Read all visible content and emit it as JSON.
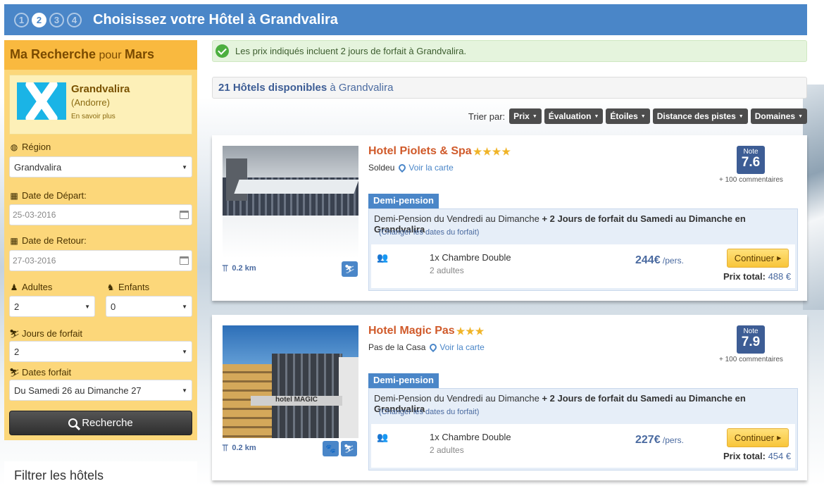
{
  "header": {
    "steps": [
      "1",
      "2",
      "3",
      "4"
    ],
    "title": "Choisissez votre Hôtel à Grandvalira"
  },
  "sidebar": {
    "title_main": "Ma Recherche",
    "title_for": " pour ",
    "title_month": "Mars",
    "resort": {
      "name": "Grandvalira",
      "country": "(Andorre)",
      "more": "En savoir plus"
    },
    "region_label": "Région",
    "region_value": "Grandvalira",
    "depart_label": "Date de Départ:",
    "depart_value": "25-03-2016",
    "return_label": "Date de Retour:",
    "return_value": "27-03-2016",
    "adults_label": "Adultes",
    "adults_value": "2",
    "children_label": "Enfants",
    "children_value": "0",
    "skidays_label": "Jours de forfait",
    "skidays_value": "2",
    "skidates_label": "Dates forfait",
    "skidates_value": "Du Samedi 26 au Dimanche 27",
    "search_button": "Recherche",
    "filter_title": "Filtrer les hôtels"
  },
  "main": {
    "notice": "Les prix indiqués incluent 2 jours de forfait à Grandvalira.",
    "count_bold": "21 Hôtels disponibles",
    "count_rest": " à Grandvalira",
    "sort_label": "Trier par:",
    "sort_buttons": [
      "Prix",
      "Évaluation",
      "Étoiles",
      "Distance des pistes",
      "Domaines"
    ]
  },
  "hotels": [
    {
      "name": "Hotel Piolets & Spa",
      "stars": "★★★★",
      "location": "Soldeu",
      "map_link": "Voir la carte",
      "note_label": "Note",
      "note": "7.6",
      "comments": "+ 100 commentaires",
      "distance": "0.2 km",
      "board": "Demi-pension",
      "offer_plain": "Demi-Pension du Vendredi au Dimanche ",
      "offer_bold": "+ 2 Jours de forfait du Samedi au Dimanche en Grandvalira",
      "change_dates": "(Changer les dates du forfait)",
      "room": "1x Chambre Double",
      "room_sub": "2 adultes",
      "price": "244€",
      "per": " /pers.",
      "continue": "Continuer",
      "total_label": "Prix total: ",
      "total": "488 €"
    },
    {
      "name": "Hotel Magic Pas",
      "stars": "★★★",
      "location": "Pas de la Casa",
      "map_link": "Voir la carte",
      "note_label": "Note",
      "note": "7.9",
      "comments": "+ 100 commentaires",
      "distance": "0.2 km",
      "board": "Demi-pension",
      "offer_plain": "Demi-Pension du Vendredi au Dimanche ",
      "offer_bold": "+ 2 Jours de forfait du Samedi au Dimanche en Grandvalira",
      "change_dates": "(Changer les dates du forfait)",
      "room": "1x Chambre Double",
      "room_sub": "2 adultes",
      "price": "227€",
      "per": " /pers.",
      "continue": "Continuer",
      "total_label": "Prix total: ",
      "total": "454 €"
    }
  ]
}
